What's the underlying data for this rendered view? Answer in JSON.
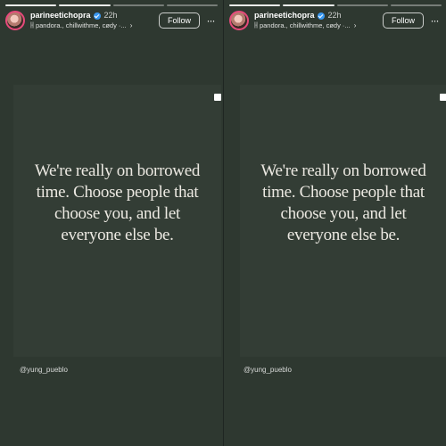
{
  "stories": [
    {
      "user": {
        "username": "parineetichopra",
        "time": "22h",
        "music": "pandora., chillwithme, cødy ·..."
      },
      "follow_label": "Follow",
      "more_icon": "···",
      "quote": "We're really on borrowed time. Choose people that choose you, and let everyone else be.",
      "credit": "@yung_pueblo"
    },
    {
      "user": {
        "username": "parineetichopra",
        "time": "22h",
        "music": "pandora., chillwithme, cødy ·..."
      },
      "follow_label": "Follow",
      "more_icon": "···",
      "quote": "We're really on borrowed time. Choose people that choose you, and let everyone else be.",
      "credit": "@yung_pueblo"
    }
  ],
  "icons": {
    "music": "music-note-icon",
    "chevron": "chevron-right-icon",
    "verified": "verified-badge-icon",
    "more": "more-options-icon"
  },
  "colors": {
    "background": "#2e3830",
    "card": "#333d35",
    "verified": "#3897f0",
    "avatar_ring": "#e74a7b"
  }
}
